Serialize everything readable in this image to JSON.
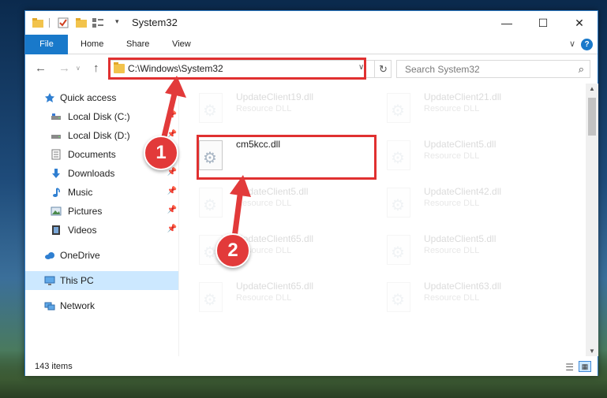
{
  "window": {
    "title": "System32",
    "controls": {
      "minimize": "—",
      "maximize": "☐",
      "close": "✕"
    }
  },
  "ribbon": {
    "tabs": [
      "File",
      "Home",
      "Share",
      "View"
    ],
    "chevron": "∨",
    "help": "?"
  },
  "address": {
    "path": "C:\\Windows\\System32",
    "dropdown": "∨",
    "refresh": "↻"
  },
  "search": {
    "placeholder": "Search System32",
    "icon": "⌕"
  },
  "nav_glyphs": {
    "back": "←",
    "forward": "→",
    "recent": "∨",
    "up": "↑"
  },
  "sidebar": {
    "items": [
      {
        "label": "Quick access",
        "icon": "star-icon",
        "pinned": false
      },
      {
        "label": "Local Disk (C:)",
        "icon": "drive-icon",
        "pinned": true
      },
      {
        "label": "Local Disk (D:)",
        "icon": "drive-icon",
        "pinned": true
      },
      {
        "label": "Documents",
        "icon": "documents-icon",
        "pinned": true
      },
      {
        "label": "Downloads",
        "icon": "download-icon",
        "pinned": true
      },
      {
        "label": "Music",
        "icon": "music-icon",
        "pinned": true
      },
      {
        "label": "Pictures",
        "icon": "pictures-icon",
        "pinned": true
      },
      {
        "label": "Videos",
        "icon": "videos-icon",
        "pinned": true
      },
      {
        "label": "OneDrive",
        "icon": "cloud-icon",
        "pinned": false
      },
      {
        "label": "This PC",
        "icon": "computer-icon",
        "pinned": false,
        "selected": true
      },
      {
        "label": "Network",
        "icon": "network-icon",
        "pinned": false
      }
    ],
    "pin_glyph": "📌"
  },
  "files": {
    "left": [
      {
        "name": "UpdateClient19.dll",
        "type": "Resource DLL",
        "faded": true
      },
      {
        "name": "cm5kcc.dll",
        "type": "",
        "faded": false,
        "highlighted": true
      },
      {
        "name": "UpdateClient5.dll",
        "type": "Resource DLL",
        "faded": true
      },
      {
        "name": "UpdateClient65.dll",
        "type": "Resource DLL",
        "faded": true
      },
      {
        "name": "UpdateClient65.dll",
        "type": "Resource DLL",
        "faded": true
      }
    ],
    "right": [
      {
        "name": "UpdateClient21.dll",
        "type": "Resource DLL",
        "faded": true
      },
      {
        "name": "UpdateClient5.dll",
        "type": "Resource DLL",
        "faded": true
      },
      {
        "name": "UpdateClient42.dll",
        "type": "Resource DLL",
        "faded": true
      },
      {
        "name": "UpdateClient5.dll",
        "type": "Resource DLL",
        "faded": true
      },
      {
        "name": "UpdateClient63.dll",
        "type": "Resource DLL",
        "faded": true
      }
    ]
  },
  "status": {
    "item_count": "143 items"
  },
  "callouts": {
    "step1": "1",
    "step2": "2"
  },
  "colors": {
    "accent": "#1979ca",
    "highlight": "#e03030",
    "selection": "#cce8ff"
  }
}
